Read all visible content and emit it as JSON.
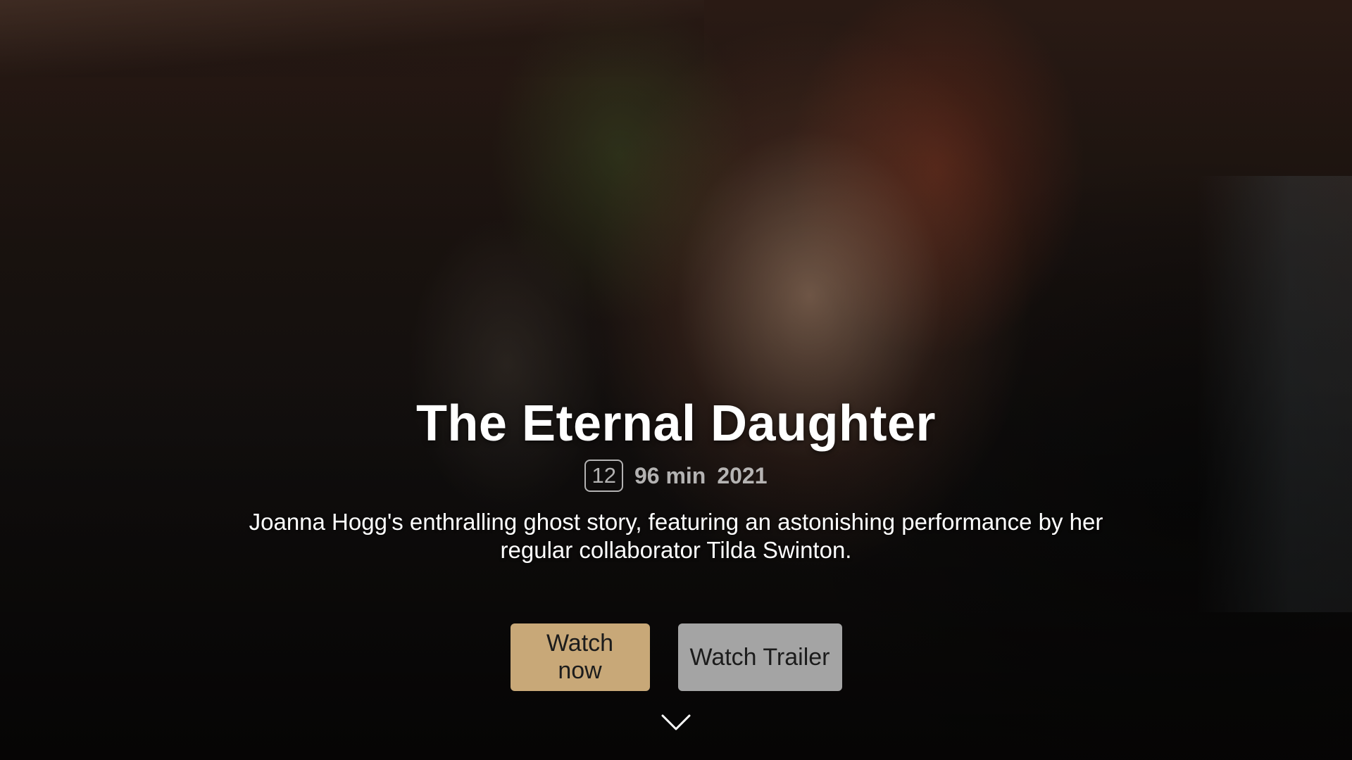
{
  "hero": {
    "title": "The Eternal Daughter",
    "rating": "12",
    "duration": "96 min",
    "year": "2021",
    "synopsis": "Joanna Hogg's enthralling ghost story, featuring an astonishing performance by her regular collaborator Tilda Swinton."
  },
  "actions": {
    "watch_now_label": "Watch now",
    "watch_trailer_label": "Watch Trailer"
  },
  "icons": {
    "scroll": "chevron-down-icon"
  },
  "colors": {
    "primary_button": "#c8a878",
    "secondary_button": "#a4a4a4",
    "text": "#ffffff",
    "meta_text": "#e1e1e1"
  }
}
